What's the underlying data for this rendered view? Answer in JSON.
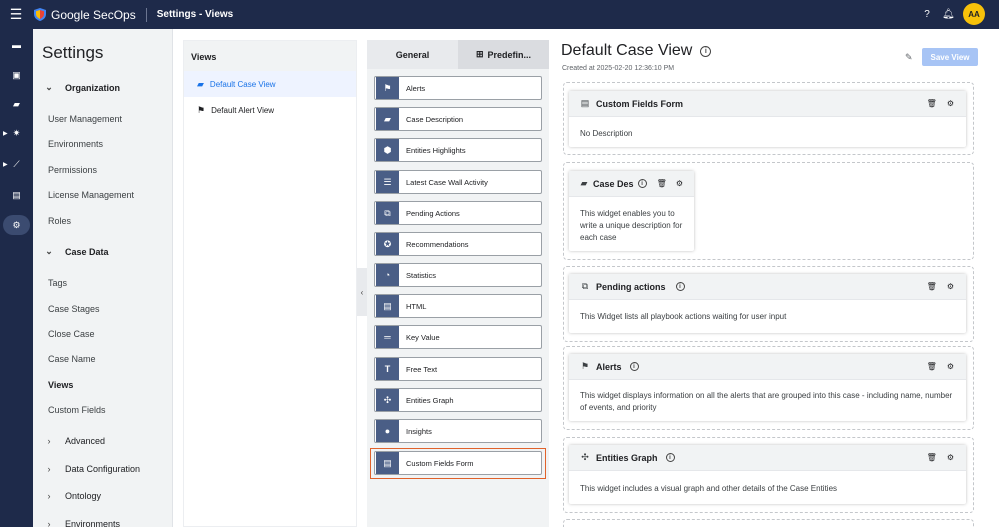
{
  "topbar": {
    "product": "Google SecOps",
    "page_title": "Settings - Views",
    "avatar_initials": "AA",
    "help_icon": "help-icon",
    "notifications_icon": "bell-icon"
  },
  "settings": {
    "title": "Settings",
    "organization": {
      "label": "Organization",
      "items": [
        "User Management",
        "Environments",
        "Permissions",
        "License Management",
        "Roles"
      ]
    },
    "case_data": {
      "label": "Case Data",
      "items": [
        "Tags",
        "Case Stages",
        "Close Case",
        "Case Name",
        "Views",
        "Custom Fields"
      ],
      "active": "Views"
    },
    "collapsed_sections": [
      "Advanced",
      "Data Configuration",
      "Ontology",
      "Environments"
    ]
  },
  "views_panel": {
    "title": "Views",
    "items": [
      {
        "label": "Default Case View",
        "selected": true
      },
      {
        "label": "Default Alert View",
        "selected": false
      }
    ]
  },
  "library": {
    "tabs": [
      "General",
      "Predefin..."
    ],
    "widgets": [
      {
        "label": "Alerts",
        "icon": "flag-icon"
      },
      {
        "label": "Case Description",
        "icon": "folder-icon"
      },
      {
        "label": "Entities Highlights",
        "icon": "badge-icon"
      },
      {
        "label": "Latest Case Wall Activity",
        "icon": "list-icon"
      },
      {
        "label": "Pending Actions",
        "icon": "pending-icon"
      },
      {
        "label": "Recommendations",
        "icon": "award-icon"
      },
      {
        "label": "Statistics",
        "icon": "pie-icon"
      },
      {
        "label": "HTML",
        "icon": "html-icon"
      },
      {
        "label": "Key Value",
        "icon": "key-value-icon"
      },
      {
        "label": "Free Text",
        "icon": "text-icon"
      },
      {
        "label": "Entities Graph",
        "icon": "graph-icon"
      },
      {
        "label": "Insights",
        "icon": "bulb-icon"
      },
      {
        "label": "Custom Fields Form",
        "icon": "form-icon"
      }
    ],
    "highlighted_widget": "Custom Fields Form",
    "highlight_color": "#e0622b"
  },
  "main": {
    "title": "Default Case View",
    "created": "Created at 2025-02-20 12:36:10 PM",
    "save_label": "Save View",
    "cards": [
      {
        "title": "Custom Fields Form",
        "body": "No Description",
        "icon": "form-icon",
        "info": false
      },
      {
        "title": "Case Des",
        "body": "This widget enables you to write a unique description for each case",
        "icon": "folder-icon",
        "info": true
      },
      {
        "title": "Pending actions",
        "body": "This Widget lists all playbook actions waiting for user input",
        "icon": "pending-icon",
        "info": true
      },
      {
        "title": "Alerts",
        "body": "This widget displays information on all the alerts that are grouped into this case - including name, number of events, and priority",
        "icon": "flag-icon",
        "info": true
      },
      {
        "title": "Entities Graph",
        "body": "This widget includes a visual graph and other details of the Case Entities",
        "icon": "graph-icon",
        "info": true
      }
    ]
  },
  "colors": {
    "topbar": "#1e2a4a",
    "accent": "#1a73e8",
    "save_button": "#a7c4f5",
    "widget_icon_bg": "#4a5e86"
  }
}
